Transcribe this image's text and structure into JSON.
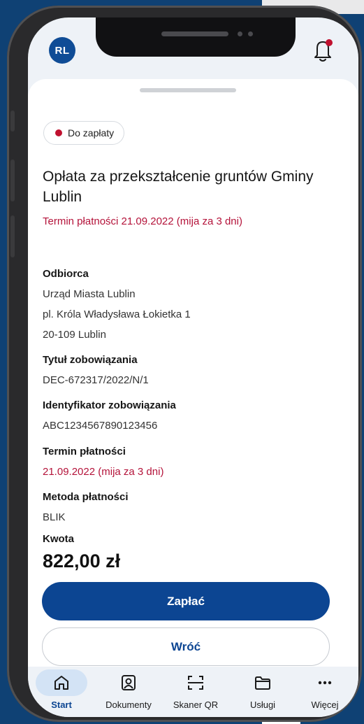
{
  "header": {
    "avatar_initials": "RL",
    "notification_dot_color": "#c0112f"
  },
  "status_chip": {
    "label": "Do zapłaty",
    "color": "#c0112f"
  },
  "payment": {
    "title": "Opłata za przekształcenie gruntów Gminy Lublin",
    "deadline_line": "Termin płatności 21.09.2022 (mija za 3 dni)"
  },
  "details": {
    "recipient_label": "Odbiorca",
    "recipient_name": "Urząd Miasta Lublin",
    "recipient_street": "pl. Króla Władysława Łokietka 1",
    "recipient_city": "20-109 Lublin",
    "obligation_title_label": "Tytuł zobowiązania",
    "obligation_title": "DEC-672317/2022/N/1",
    "obligation_id_label": "Identyfikator zobowiązania",
    "obligation_id": "ABC1234567890123456",
    "due_label": "Termin płatności",
    "due_value": "21.09.2022 (mija za 3 dni)",
    "method_label": "Metoda płatności",
    "method_value": "BLIK",
    "amount_label": "Kwota",
    "amount_value": "822,00 zł"
  },
  "actions": {
    "pay_label": "Zapłać",
    "back_label": "Wróć"
  },
  "nav": {
    "items": [
      {
        "label": "Start",
        "icon": "home-icon",
        "active": true
      },
      {
        "label": "Dokumenty",
        "icon": "id-card-icon",
        "active": false
      },
      {
        "label": "Skaner QR",
        "icon": "qr-scanner-icon",
        "active": false
      },
      {
        "label": "Usługi",
        "icon": "folder-icon",
        "active": false
      },
      {
        "label": "Więcej",
        "icon": "more-dots-icon",
        "active": false
      }
    ]
  },
  "colors": {
    "brand_blue": "#0c4592",
    "alert_red": "#b4133a",
    "background_blue": "#0f4174"
  }
}
